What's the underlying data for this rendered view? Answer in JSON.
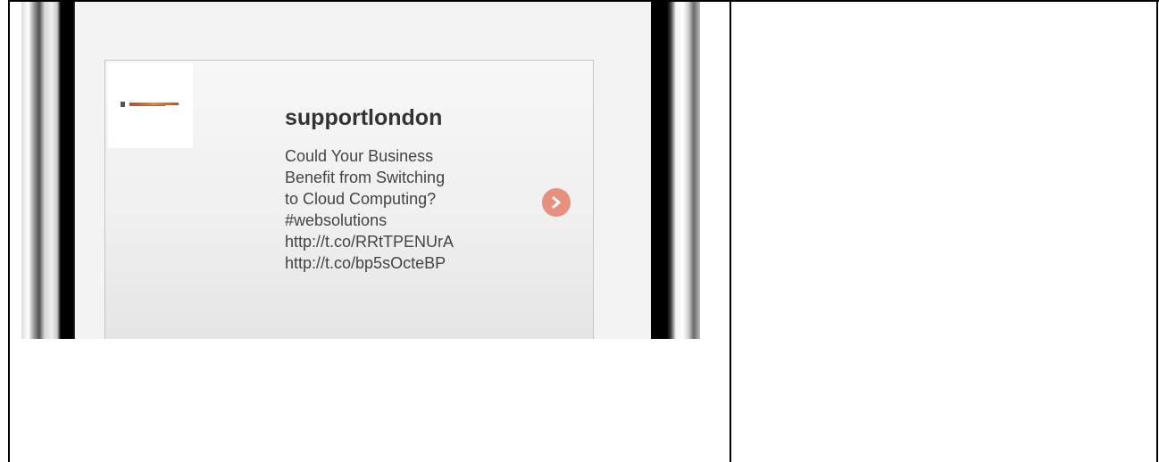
{
  "tweet_card": {
    "username": "supportlondon",
    "lines": [
      "Could Your Business",
      "Benefit from Switching",
      "to Cloud Computing?",
      "#websolutions",
      "http://t.co/RRtTPENUrA",
      "http://t.co/bp5sOcteBP"
    ],
    "next_icon": "chevron-right-circle-icon"
  },
  "colors": {
    "accent": "#e8907f",
    "text": "#444444",
    "handle": "#333333"
  }
}
